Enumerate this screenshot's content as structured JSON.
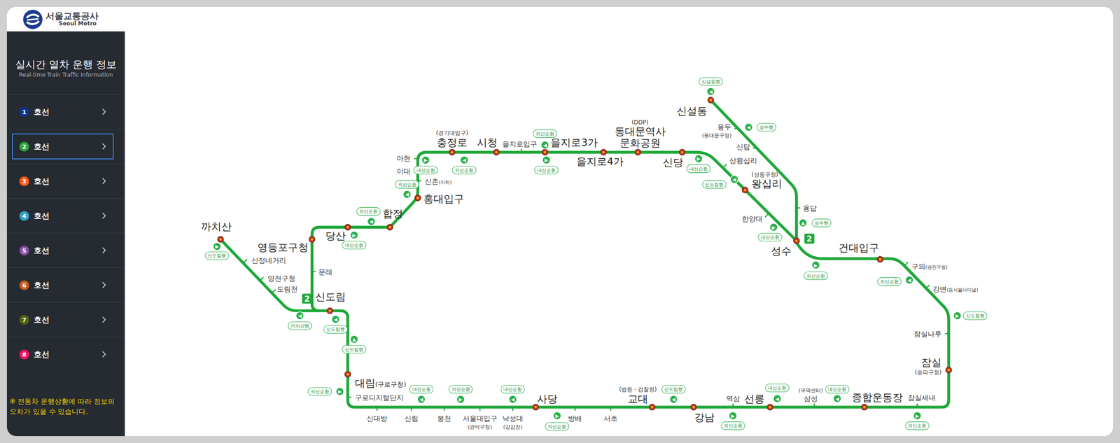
{
  "logo": {
    "title": "서울교통공사",
    "subtitle": "Seoul Metro"
  },
  "sidebar": {
    "title": "실시간 열차 운행 정보",
    "subtitle": "Real-time Train Traffic Information",
    "items": [
      {
        "number": "1",
        "label": "호선",
        "color": "#0d3692",
        "selected": false
      },
      {
        "number": "2",
        "label": "호선",
        "color": "#33a23d",
        "selected": true
      },
      {
        "number": "3",
        "label": "호선",
        "color": "#fe5b10",
        "selected": false
      },
      {
        "number": "4",
        "label": "호선",
        "color": "#32a1c8",
        "selected": false
      },
      {
        "number": "5",
        "label": "호선",
        "color": "#8b50a4",
        "selected": false
      },
      {
        "number": "6",
        "label": "호선",
        "color": "#c55c1d",
        "selected": false
      },
      {
        "number": "7",
        "label": "호선",
        "color": "#54640d",
        "selected": false
      },
      {
        "number": "8",
        "label": "호선",
        "color": "#f51361",
        "selected": false
      }
    ],
    "note": "※ 전동차 운행상황에 따라 정보의 오차가 있을 수 있습니다."
  },
  "map": {
    "line_badges": [
      "2",
      "2"
    ],
    "stations": [
      {
        "name": "충정로",
        "note": "(경기대입구)",
        "kind": "transfer"
      },
      {
        "name": "시청",
        "kind": "transfer"
      },
      {
        "name": "을지로입구",
        "kind": "stop"
      },
      {
        "name": "을지로3가",
        "kind": "transfer"
      },
      {
        "name": "을지로4가",
        "kind": "transfer"
      },
      {
        "name": "동대문역사",
        "name2": "문화공원",
        "note": "(DDP)",
        "kind": "transfer"
      },
      {
        "name": "신당",
        "kind": "transfer"
      },
      {
        "name": "상왕십리",
        "kind": "stop"
      },
      {
        "name": "왕십리",
        "note": "(성동구청)",
        "kind": "transfer"
      },
      {
        "name": "한양대",
        "kind": "stop"
      },
      {
        "name": "성수",
        "kind": "transfer"
      },
      {
        "name": "건대입구",
        "kind": "transfer"
      },
      {
        "name": "구의",
        "note": "(광진구청)",
        "kind": "stop"
      },
      {
        "name": "강변",
        "note": "(동서울터미널)",
        "kind": "stop"
      },
      {
        "name": "잠실나루",
        "kind": "stop"
      },
      {
        "name": "잠실",
        "note": "(송파구청)",
        "kind": "transfer"
      },
      {
        "name": "잠실새내",
        "kind": "stop"
      },
      {
        "name": "종합운동장",
        "kind": "transfer"
      },
      {
        "name": "삼성",
        "note": "(무역센터)",
        "kind": "stop"
      },
      {
        "name": "선릉",
        "kind": "transfer"
      },
      {
        "name": "역삼",
        "kind": "stop"
      },
      {
        "name": "강남",
        "kind": "transfer"
      },
      {
        "name": "교대",
        "note": "(법원・검찰청)",
        "kind": "transfer"
      },
      {
        "name": "서초",
        "kind": "stop"
      },
      {
        "name": "방배",
        "kind": "stop"
      },
      {
        "name": "사당",
        "kind": "transfer"
      },
      {
        "name": "낙성대",
        "note": "(강감찬)",
        "kind": "stop"
      },
      {
        "name": "서울대입구",
        "note": "(관악구청)",
        "kind": "stop"
      },
      {
        "name": "봉천",
        "kind": "stop"
      },
      {
        "name": "신림",
        "kind": "stop"
      },
      {
        "name": "신대방",
        "kind": "stop"
      },
      {
        "name": "구로디지털단지",
        "kind": "stop"
      },
      {
        "name": "대림",
        "note": "(구로구청)",
        "kind": "transfer"
      },
      {
        "name": "신도림",
        "kind": "transfer"
      },
      {
        "name": "문래",
        "kind": "stop"
      },
      {
        "name": "영등포구청",
        "kind": "transfer"
      },
      {
        "name": "당산",
        "kind": "transfer"
      },
      {
        "name": "합정",
        "kind": "transfer"
      },
      {
        "name": "홍대입구",
        "kind": "transfer"
      },
      {
        "name": "신촌",
        "note": "(지하)",
        "kind": "stop"
      },
      {
        "name": "이대",
        "kind": "stop"
      },
      {
        "name": "아현",
        "kind": "stop"
      },
      {
        "name": "까치산",
        "kind": "transfer"
      },
      {
        "name": "신정네거리",
        "kind": "stop"
      },
      {
        "name": "양천구청",
        "kind": "stop"
      },
      {
        "name": "도림천",
        "kind": "stop"
      },
      {
        "name": "용답",
        "kind": "stop"
      },
      {
        "name": "신답",
        "kind": "stop"
      },
      {
        "name": "용두",
        "note": "(동대문구청)",
        "kind": "stop"
      },
      {
        "name": "신설동",
        "kind": "transfer"
      }
    ],
    "trains": [
      {
        "label": "신설동행",
        "arrow": "◀"
      },
      {
        "label": "성수행",
        "arrow": "◀"
      },
      {
        "label": "내선순환",
        "arrow": "▶"
      },
      {
        "label": "신도림행",
        "arrow": "◀"
      },
      {
        "label": "내선순환",
        "arrow": "▶"
      },
      {
        "label": "성수행",
        "arrow": "▲"
      },
      {
        "label": "외선순환",
        "arrow": "▶"
      },
      {
        "label": "외선순환",
        "arrow": "◀"
      },
      {
        "label": "신도림행",
        "arrow": "▶"
      },
      {
        "label": "외선순환",
        "arrow": "▶"
      },
      {
        "label": "내선순환",
        "arrow": "◀"
      },
      {
        "label": "내선순환",
        "arrow": "◀"
      },
      {
        "label": "외선순환",
        "arrow": "▶"
      },
      {
        "label": "신도림행",
        "arrow": "◀"
      },
      {
        "label": "외선순환",
        "arrow": "▶"
      },
      {
        "label": "내선순환",
        "arrow": "◀"
      },
      {
        "label": "외선순환",
        "arrow": "▶"
      },
      {
        "label": "내선순환",
        "arrow": "◀"
      },
      {
        "label": "외선순환",
        "arrow": "▶"
      },
      {
        "label": "신도림행",
        "arrow": "▲"
      },
      {
        "label": "신도림행",
        "arrow": "◀"
      },
      {
        "label": "까치산행",
        "arrow": "◀"
      },
      {
        "label": "신도림행",
        "arrow": "▶"
      },
      {
        "label": "내선순환",
        "arrow": "▶"
      },
      {
        "label": "외선순환",
        "arrow": "◀"
      },
      {
        "label": "외선순환",
        "arrow": "◀"
      },
      {
        "label": "내선순환",
        "arrow": "▶"
      },
      {
        "label": "외선순환",
        "arrow": "◀"
      },
      {
        "label": "외선순환",
        "arrow": "◀"
      },
      {
        "label": "내선순환",
        "arrow": "▶"
      }
    ]
  }
}
